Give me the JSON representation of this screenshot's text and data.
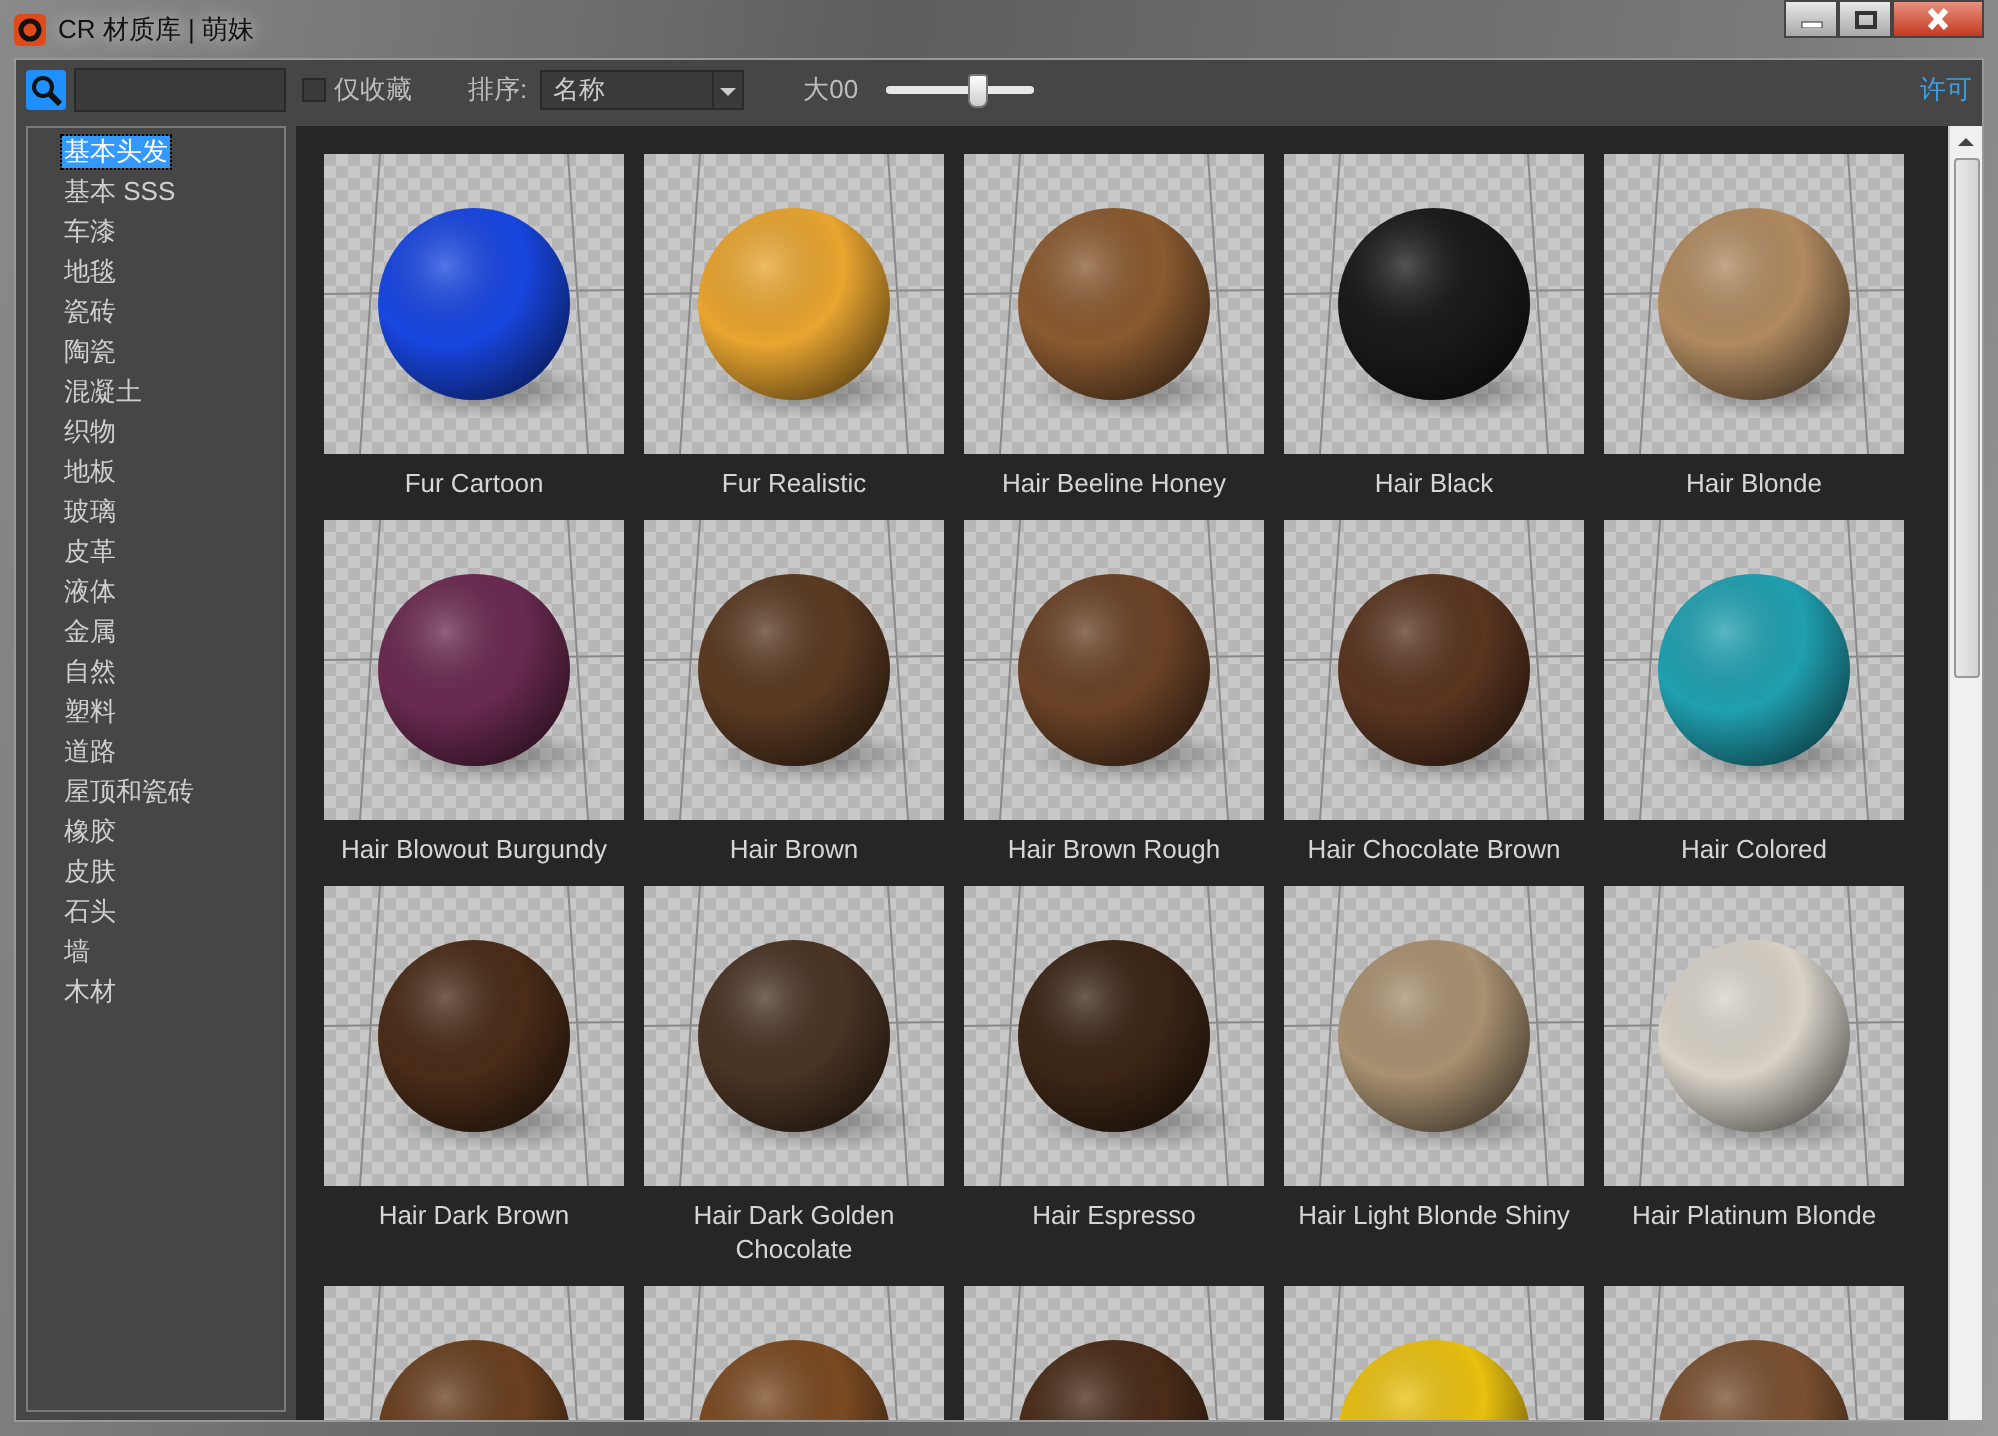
{
  "window": {
    "title": "CR 材质库 | 萌妹"
  },
  "toolbar": {
    "favorites_only": {
      "label": "仅收藏",
      "checked": false
    },
    "sort": {
      "label": "排序:",
      "value": "名称"
    },
    "size": {
      "label": "大00",
      "level": 0.62
    },
    "license_link": "许可"
  },
  "sidebar": {
    "items": [
      {
        "label": "基本头发",
        "selected": true
      },
      {
        "label": "基本 SSS",
        "selected": false
      },
      {
        "label": "车漆",
        "selected": false
      },
      {
        "label": "地毯",
        "selected": false
      },
      {
        "label": "瓷砖",
        "selected": false
      },
      {
        "label": "陶瓷",
        "selected": false
      },
      {
        "label": "混凝土",
        "selected": false
      },
      {
        "label": "织物",
        "selected": false
      },
      {
        "label": "地板",
        "selected": false
      },
      {
        "label": "玻璃",
        "selected": false
      },
      {
        "label": "皮革",
        "selected": false
      },
      {
        "label": "液体",
        "selected": false
      },
      {
        "label": "金属",
        "selected": false
      },
      {
        "label": "自然",
        "selected": false
      },
      {
        "label": "塑料",
        "selected": false
      },
      {
        "label": "道路",
        "selected": false
      },
      {
        "label": "屋顶和瓷砖",
        "selected": false
      },
      {
        "label": "橡胶",
        "selected": false
      },
      {
        "label": "皮肤",
        "selected": false
      },
      {
        "label": "石头",
        "selected": false
      },
      {
        "label": "墙",
        "selected": false
      },
      {
        "label": "木材",
        "selected": false
      }
    ]
  },
  "materials": [
    {
      "name": "Fur Cartoon",
      "color": "#1846e0"
    },
    {
      "name": "Fur Realistic",
      "color": "#e8a530"
    },
    {
      "name": "Hair Beeline Honey",
      "color": "#8a5a30"
    },
    {
      "name": "Hair Black",
      "color": "#1a1a1a"
    },
    {
      "name": "Hair Blonde",
      "color": "#b08a60"
    },
    {
      "name": "Hair Blowout Burgundy",
      "color": "#6a2a50"
    },
    {
      "name": "Hair Brown",
      "color": "#5a3a22"
    },
    {
      "name": "Hair Brown Rough",
      "color": "#6a4226"
    },
    {
      "name": "Hair Chocolate Brown",
      "color": "#5a3520"
    },
    {
      "name": "Hair Colored",
      "color": "#20a0b0"
    },
    {
      "name": "Hair Dark Brown",
      "color": "#4a2c18"
    },
    {
      "name": "Hair Dark Golden Chocolate",
      "color": "#4a3424"
    },
    {
      "name": "Hair Espresso",
      "color": "#3c2616"
    },
    {
      "name": "Hair Light Blonde Shiny",
      "color": "#a89070"
    },
    {
      "name": "Hair Platinum Blonde",
      "color": "#d8d2c8"
    },
    {
      "color": "#6a4020"
    },
    {
      "color": "#7a4a22"
    },
    {
      "color": "#4a2c18"
    },
    {
      "color": "#e8c010"
    },
    {
      "color": "#7a5030"
    }
  ]
}
